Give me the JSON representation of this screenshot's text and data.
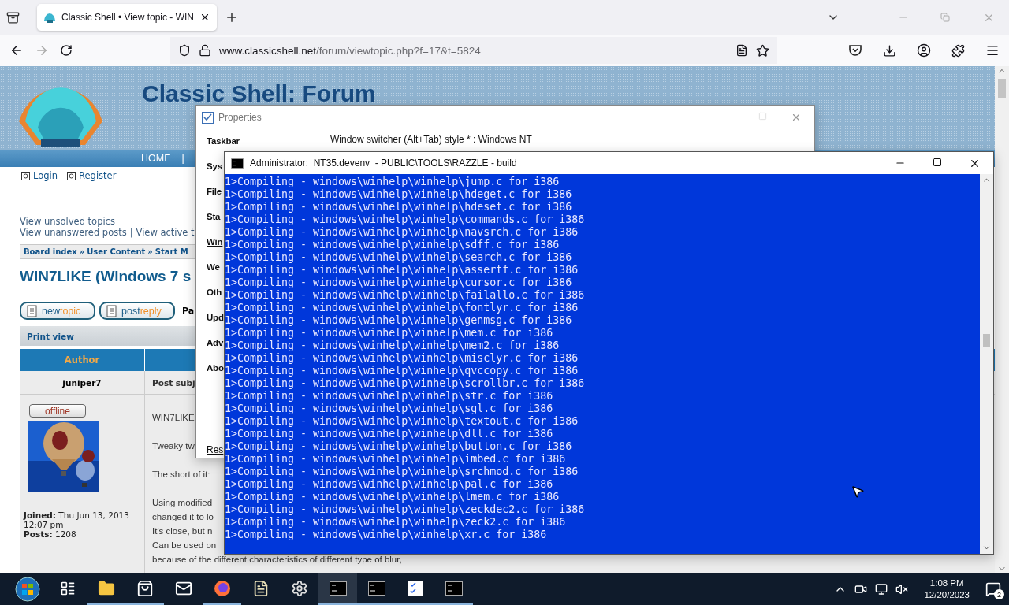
{
  "browser": {
    "tabs": [
      {
        "title": "Classic Shell • View topic - WIN",
        "selected": true
      }
    ],
    "url_host": "www.classicshell.net",
    "url_path": "/forum/viewtopic.php?f=17&t=5824"
  },
  "forum": {
    "title": "Classic Shell: Forum",
    "nav": [
      "HOME",
      "|"
    ],
    "user_links": [
      "Login",
      "Register"
    ],
    "quick_links": [
      [
        "View unsolved topics"
      ],
      [
        "View unanswered posts",
        "|",
        "View active t"
      ]
    ],
    "breadcrumbs": [
      "Board index",
      "»",
      "User Content",
      "»",
      "Start M"
    ],
    "topic_title": "WIN7LIKE (Windows 7 s",
    "buttons": [
      {
        "lead": "new",
        "rest": "topic"
      },
      {
        "lead": "post",
        "rest": "reply"
      }
    ],
    "pagination": "Pa",
    "print_view": "Print view",
    "columns": [
      "Author"
    ],
    "author": {
      "name": "juniper7",
      "status": "offline",
      "joined": "**Joined:** Thu Jun 13, 2013 12:07 pm",
      "posts": "**Posts:** 1208"
    },
    "post": {
      "subject": "Post subj",
      "paragraphs": [
        [
          "WIN7LIKE"
        ],
        [
          "Tweaky tw"
        ],
        [
          "The short of it:"
        ],
        [
          "Using modified",
          "changed it to lo",
          "It's close, but n",
          "Can be used on",
          "because of the different characteristics of different type of blur,"
        ]
      ]
    }
  },
  "properties": {
    "title": "Properties",
    "setting": "Window switcher (Alt+Tab) style * : Windows NT",
    "reset": "Res",
    "sections": [
      {
        "label": "Taskbar",
        "selected": false
      },
      {
        "label": "Sys",
        "selected": false
      },
      {
        "label": "File",
        "selected": false
      },
      {
        "label": "Sta",
        "selected": false
      },
      {
        "label": "Win",
        "selected": true
      },
      {
        "label": "We",
        "selected": false
      },
      {
        "label": "Oth",
        "selected": false
      },
      {
        "label": "Upd",
        "selected": false
      },
      {
        "label": "Adv",
        "selected": false
      },
      {
        "label": "Abo",
        "selected": false
      }
    ]
  },
  "console": {
    "title": "Administrator:  NT35.devenv  - PUBLIC\\TOOLS\\RAZZLE - build",
    "lines": [
      "1>Compiling - windows\\winhelp\\winhelp\\jump.c for i386",
      "1>Compiling - windows\\winhelp\\winhelp\\hdeget.c for i386",
      "1>Compiling - windows\\winhelp\\winhelp\\hdeset.c for i386",
      "1>Compiling - windows\\winhelp\\winhelp\\commands.c for i386",
      "1>Compiling - windows\\winhelp\\winhelp\\navsrch.c for i386",
      "1>Compiling - windows\\winhelp\\winhelp\\sdff.c for i386",
      "1>Compiling - windows\\winhelp\\winhelp\\search.c for i386",
      "1>Compiling - windows\\winhelp\\winhelp\\assertf.c for i386",
      "1>Compiling - windows\\winhelp\\winhelp\\cursor.c for i386",
      "1>Compiling - windows\\winhelp\\winhelp\\failallo.c for i386",
      "1>Compiling - windows\\winhelp\\winhelp\\fontlyr.c for i386",
      "1>Compiling - windows\\winhelp\\winhelp\\genmsg.c for i386",
      "1>Compiling - windows\\winhelp\\winhelp\\mem.c for i386",
      "1>Compiling - windows\\winhelp\\winhelp\\mem2.c for i386",
      "1>Compiling - windows\\winhelp\\winhelp\\misclyr.c for i386",
      "1>Compiling - windows\\winhelp\\winhelp\\qvccopy.c for i386",
      "1>Compiling - windows\\winhelp\\winhelp\\scrollbr.c for i386",
      "1>Compiling - windows\\winhelp\\winhelp\\str.c for i386",
      "1>Compiling - windows\\winhelp\\winhelp\\sgl.c for i386",
      "1>Compiling - windows\\winhelp\\winhelp\\textout.c for i386",
      "1>Compiling - windows\\winhelp\\winhelp\\dll.c for i386",
      "1>Compiling - windows\\winhelp\\winhelp\\button.c for i386",
      "1>Compiling - windows\\winhelp\\winhelp\\imbed.c for i386",
      "1>Compiling - windows\\winhelp\\winhelp\\srchmod.c for i386",
      "1>Compiling - windows\\winhelp\\winhelp\\pal.c for i386",
      "1>Compiling - windows\\winhelp\\winhelp\\lmem.c for i386",
      "1>Compiling - windows\\winhelp\\winhelp\\zeckdec2.c for i386",
      "1>Compiling - windows\\winhelp\\winhelp\\zeck2.c for i386",
      "1>Compiling - windows\\winhelp\\winhelp\\xr.c for i386"
    ]
  },
  "taskbar": {
    "apps": [
      {
        "kind": "taskview",
        "running": false,
        "active": false
      },
      {
        "kind": "folder",
        "running": true,
        "active": false
      },
      {
        "kind": "store",
        "running": true,
        "active": false
      },
      {
        "kind": "mail",
        "running": false,
        "active": false
      },
      {
        "kind": "firefox",
        "running": true,
        "active": false
      },
      {
        "kind": "notepad",
        "running": false,
        "active": false
      },
      {
        "kind": "gear",
        "running": false,
        "active": false
      },
      {
        "kind": "console",
        "running": true,
        "active": true
      },
      {
        "kind": "console",
        "running": true,
        "active": false
      },
      {
        "kind": "properties",
        "running": true,
        "active": false
      },
      {
        "kind": "console",
        "running": true,
        "active": false
      }
    ],
    "time": "1:08 PM",
    "date": "12/20/2023",
    "notifications": "2"
  }
}
